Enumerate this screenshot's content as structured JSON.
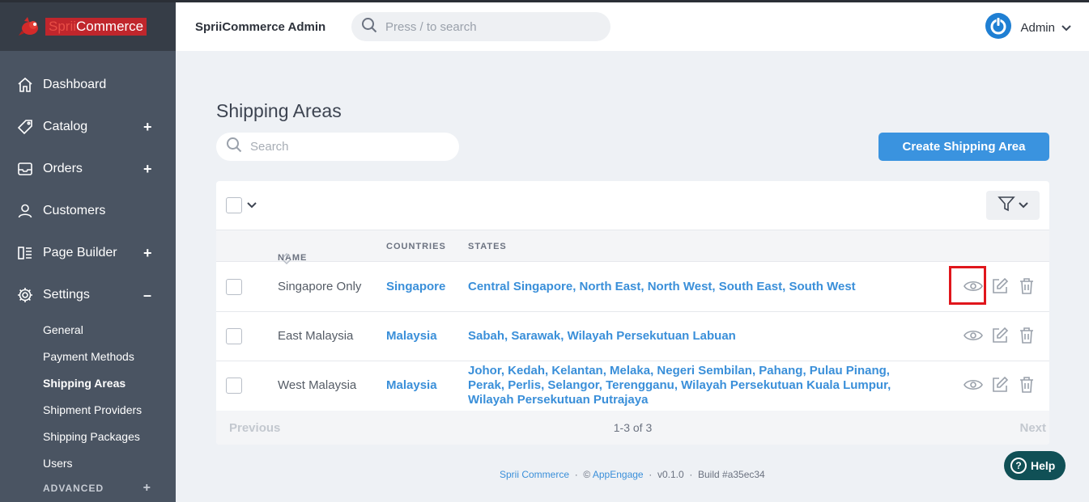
{
  "brand": {
    "prefix": "Sprii",
    "suffix": "Commerce"
  },
  "header": {
    "title": "SpriiCommerce Admin",
    "search_placeholder": "Press / to search",
    "user_name": "Admin"
  },
  "sidebar": {
    "items": [
      {
        "label": "Dashboard",
        "icon": "home-icon",
        "toggle": ""
      },
      {
        "label": "Catalog",
        "icon": "tag-icon",
        "toggle": "+"
      },
      {
        "label": "Orders",
        "icon": "inbox-icon",
        "toggle": "+"
      },
      {
        "label": "Customers",
        "icon": "user-icon",
        "toggle": ""
      },
      {
        "label": "Page Builder",
        "icon": "layout-icon",
        "toggle": "+"
      },
      {
        "label": "Settings",
        "icon": "gear-icon",
        "toggle": "–"
      }
    ],
    "settings_sub": [
      "General",
      "Payment Methods",
      "Shipping Areas",
      "Shipment Providers",
      "Shipping Packages",
      "Users"
    ],
    "active_sub": "Shipping Areas",
    "advanced": {
      "label": "ADVANCED",
      "toggle": "+"
    }
  },
  "main": {
    "title": "Shipping Areas",
    "search_placeholder": "Search",
    "create_label": "Create Shipping Area"
  },
  "table": {
    "headers": {
      "name": "NAME",
      "countries": "COUNTRIES",
      "states": "STATES"
    },
    "rows": [
      {
        "name": "Singapore Only",
        "country": "Singapore",
        "states": "Central Singapore, North East, North West, South East, South West"
      },
      {
        "name": "East Malaysia",
        "country": "Malaysia",
        "states": "Sabah, Sarawak, Wilayah Persekutuan Labuan"
      },
      {
        "name": "West Malaysia",
        "country": "Malaysia",
        "states": "Johor, Kedah, Kelantan, Melaka, Negeri Sembilan, Pahang, Pulau Pinang, Perak, Perlis, Selangor, Terengganu, Wilayah Persekutuan Kuala Lumpur, Wilayah Persekutuan Putrajaya"
      }
    ],
    "pagination": {
      "prev": "Previous",
      "count": "1-3 of 3",
      "next": "Next"
    }
  },
  "footer": {
    "brand_link": "Sprii Commerce",
    "sep": "·",
    "copyright": "©",
    "company_link": "AppEngage",
    "version": "v0.1.0",
    "build": "Build #a35ec34"
  },
  "help": {
    "label": "Help"
  },
  "colors": {
    "accent": "#3a93df",
    "sidebar": "#4a5462",
    "highlight": "#e0161c",
    "help": "#105056"
  }
}
